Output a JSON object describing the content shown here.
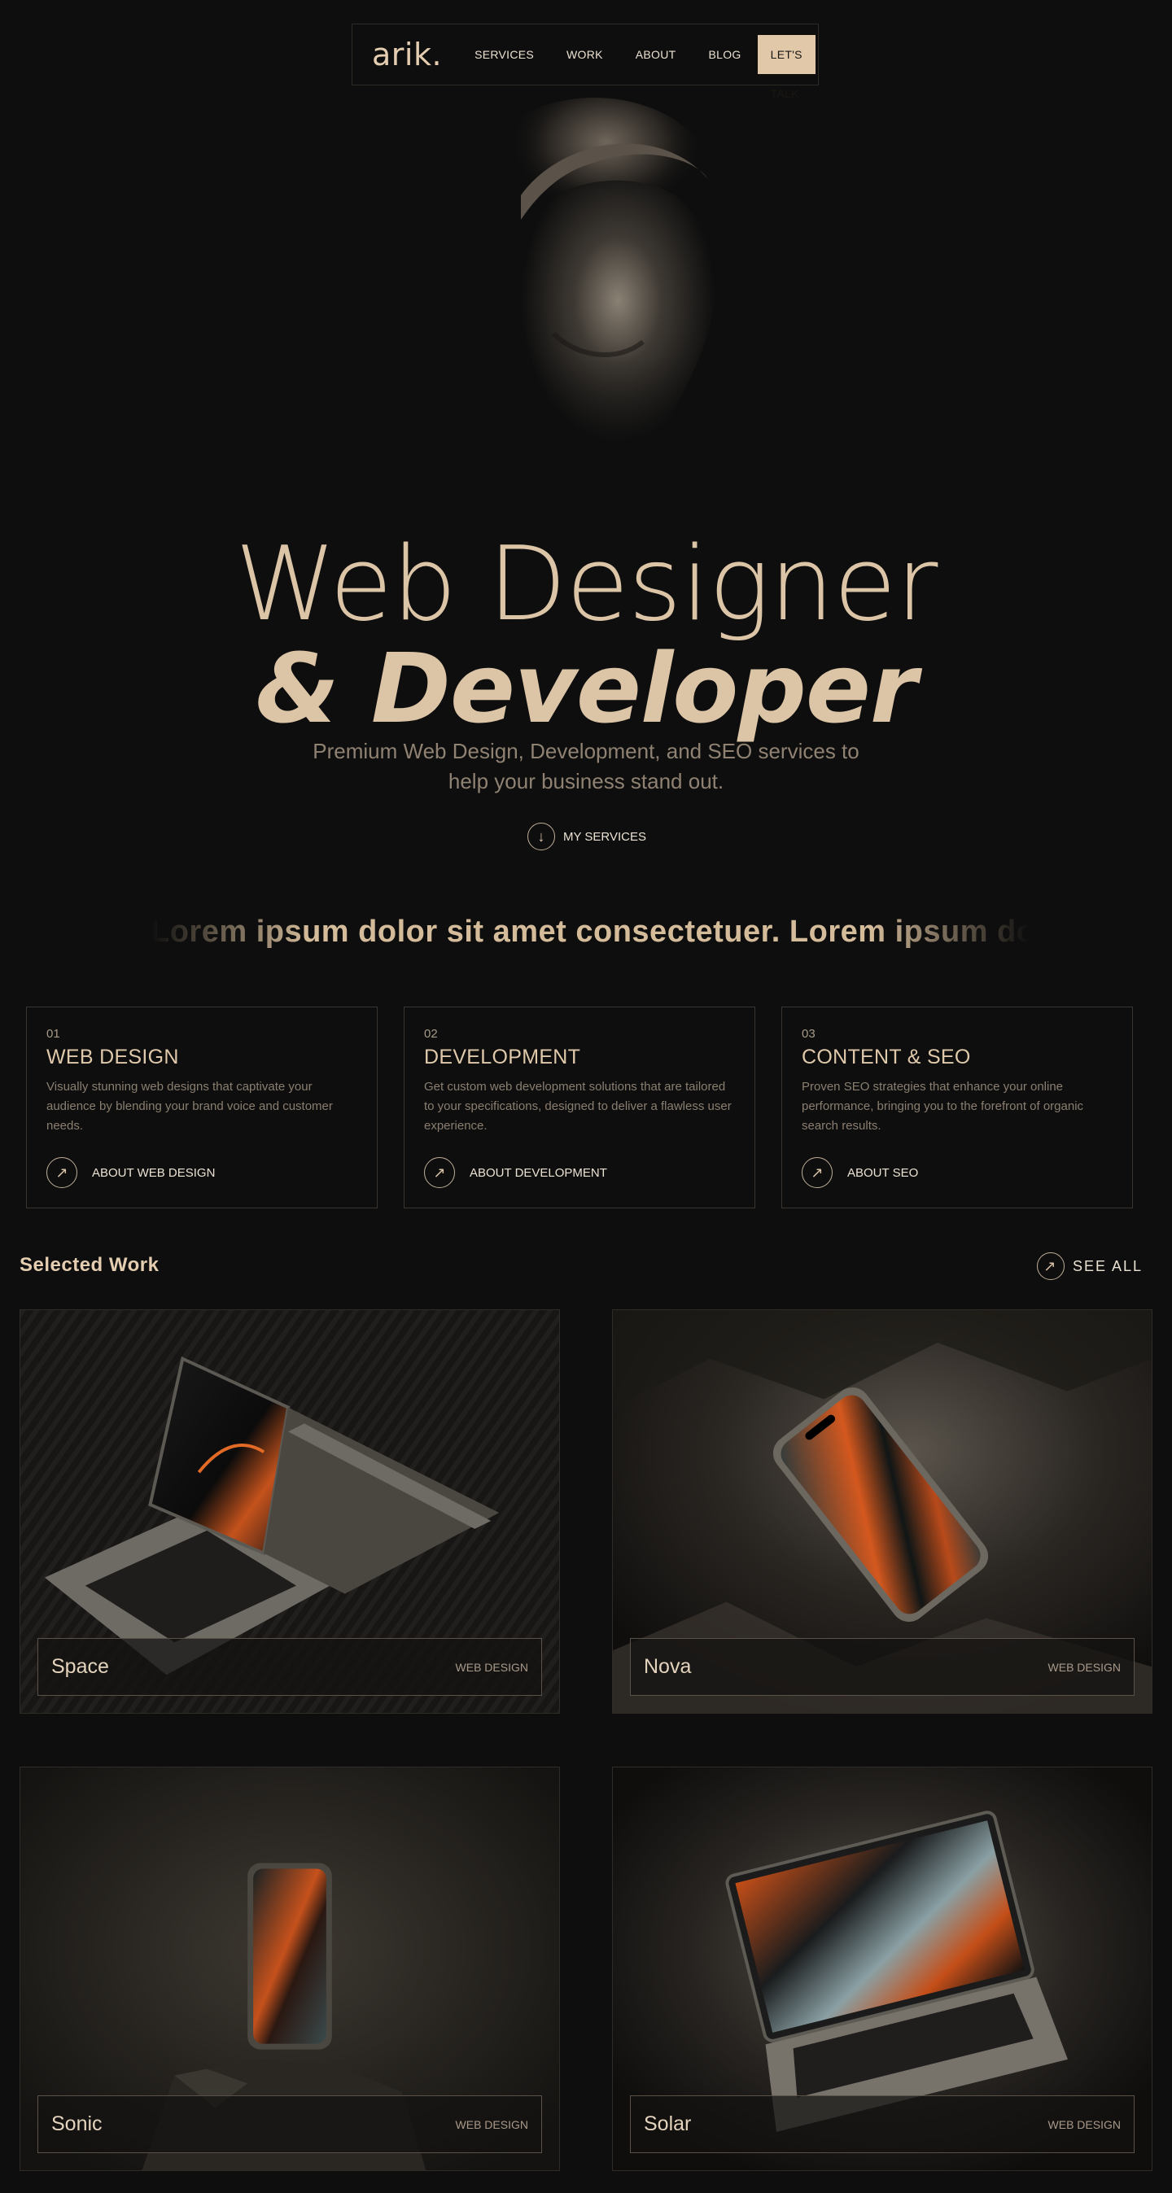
{
  "nav": {
    "logo": "arik.",
    "links": [
      "SERVICES",
      "WORK",
      "ABOUT",
      "BLOG"
    ],
    "cta": "LET'S TALK"
  },
  "hero": {
    "title_line1": "Web Designer",
    "title_line2": "& Developer",
    "subtitle": "Premium Web Design, Development, and SEO services to help your business stand out.",
    "services_link": "MY SERVICES"
  },
  "marquee": {
    "text": "Lorem ipsum dolor sit amet consectetuer.  Lorem ipsum dolor"
  },
  "services": [
    {
      "num": "01",
      "title": "WEB DESIGN",
      "desc": "Visually stunning web designs that captivate your audience by blending your brand voice and customer needs.",
      "link": "ABOUT WEB DESIGN"
    },
    {
      "num": "02",
      "title": "DEVELOPMENT",
      "desc": "Get custom web development solutions that are tailored to your specifications, designed to deliver a flawless user experience.",
      "link": "ABOUT DEVELOPMENT"
    },
    {
      "num": "03",
      "title": "CONTENT & SEO",
      "desc": "Proven SEO strategies that enhance your online performance, bringing you to the forefront of organic search results.",
      "link": "ABOUT SEO"
    }
  ],
  "work": {
    "title": "Selected Work",
    "see_all": "SEE ALL",
    "projects": [
      {
        "name": "Space",
        "tag": "WEB DESIGN"
      },
      {
        "name": "Nova",
        "tag": "WEB DESIGN"
      },
      {
        "name": "Sonic",
        "tag": "WEB DESIGN"
      },
      {
        "name": "Solar",
        "tag": "WEB DESIGN"
      }
    ]
  },
  "colors": {
    "background": "#0e0e0e",
    "accent": "#dcc4a6",
    "cta_bg": "#e0c8a8"
  },
  "icons": {
    "arrow_down": "arrow-down-icon",
    "arrow_up_right": "arrow-up-right-icon"
  }
}
